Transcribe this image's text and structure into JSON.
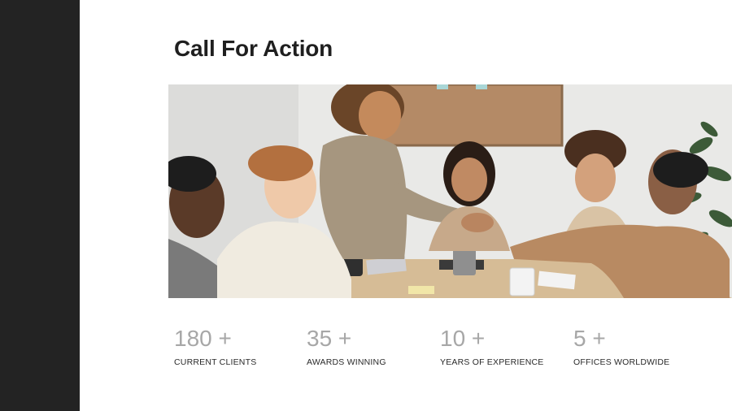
{
  "slide": {
    "title": "Call For Action",
    "sidebar_color": "#232323",
    "photo_description_icon": "team-meeting-photo"
  },
  "stats": [
    {
      "value": "180 +",
      "label": "CURRENT CLIENTS"
    },
    {
      "value": "35 +",
      "label": "AWARDS WINNING"
    },
    {
      "value": "10 +",
      "label": "YEARS OF EXPERIENCE"
    },
    {
      "value": "5 +",
      "label": "OFFICES WORLDWIDE"
    }
  ]
}
